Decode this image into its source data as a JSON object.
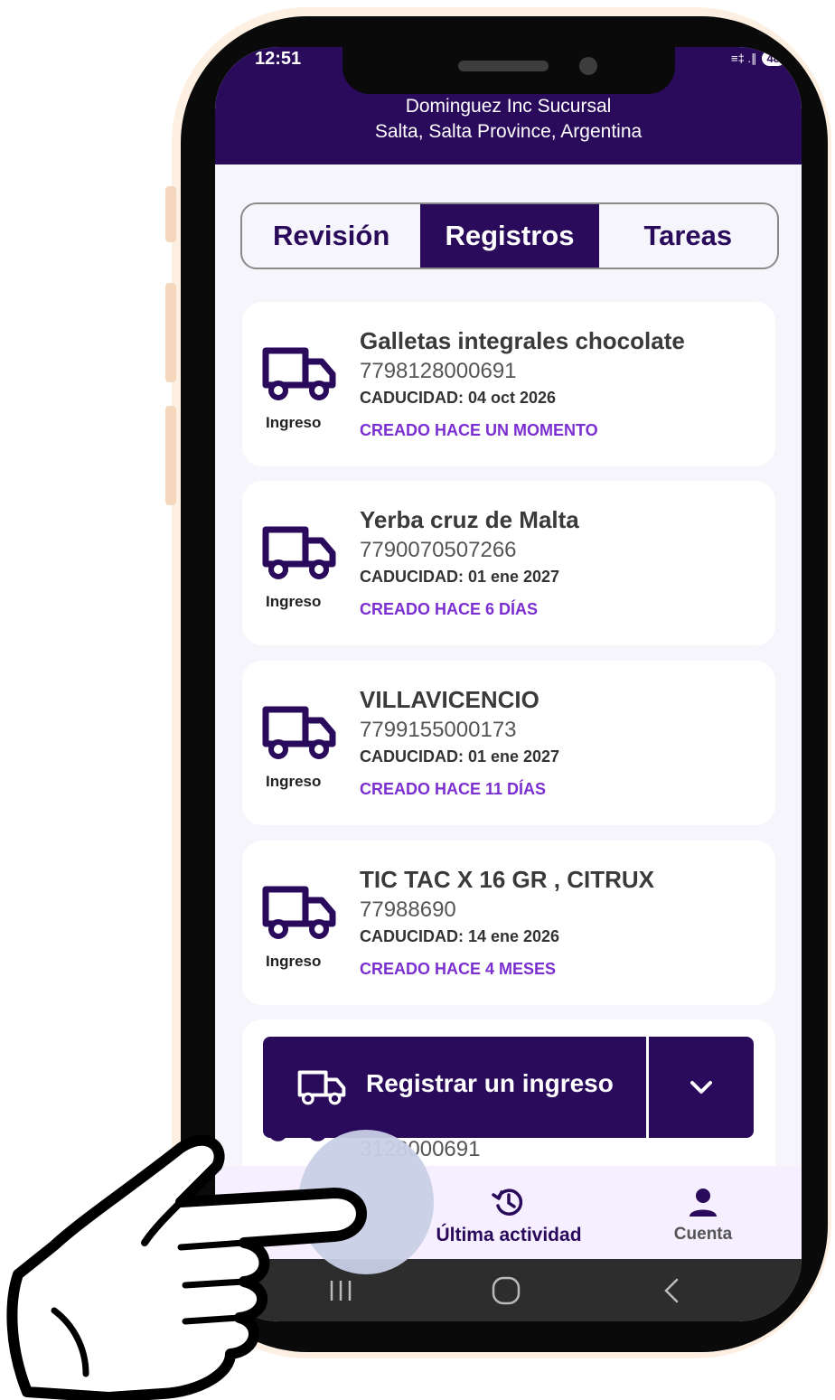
{
  "status_bar": {
    "time": "12:51",
    "signal": "≡‡ .∥",
    "battery": "48"
  },
  "header": {
    "line1": "Dominguez Inc Sucursal",
    "line2": "Salta, Salta Province, Argentina"
  },
  "tabs": [
    {
      "label": "Revisión",
      "active": false
    },
    {
      "label": "Registros",
      "active": true
    },
    {
      "label": "Tareas",
      "active": false
    }
  ],
  "records": [
    {
      "type": "Ingreso",
      "name": "Galletas integrales chocolate",
      "code": "7798128000691",
      "expiry": "CADUCIDAD: 04 oct 2026",
      "created": "CREADO HACE UN MOMENTO"
    },
    {
      "type": "Ingreso",
      "name": "Yerba cruz de Malta",
      "code": "7790070507266",
      "expiry": "CADUCIDAD: 01 ene 2027",
      "created": "CREADO HACE 6 DÍAS"
    },
    {
      "type": "Ingreso",
      "name": "VILLAVICENCIO",
      "code": "7799155000173",
      "expiry": "CADUCIDAD: 01 ene 2027",
      "created": "CREADO HACE 11 DÍAS"
    },
    {
      "type": "Ingreso",
      "name": "TIC TAC X 16 GR , CITRUX",
      "code": "77988690",
      "expiry": "CADUCIDAD: 14 ene 2026",
      "created": "CREADO HACE 4 MESES"
    }
  ],
  "partial_record": {
    "code_fragment": "3128000691"
  },
  "fab": {
    "label": "Registrar un ingreso"
  },
  "bottom_nav": [
    {
      "label": "Última actividad",
      "icon": "history-icon"
    },
    {
      "label": "Cuenta",
      "icon": "person-icon"
    }
  ],
  "colors": {
    "primary": "#2a0a5b",
    "accent": "#7b2fd0",
    "nav_bg": "#f5efff"
  }
}
